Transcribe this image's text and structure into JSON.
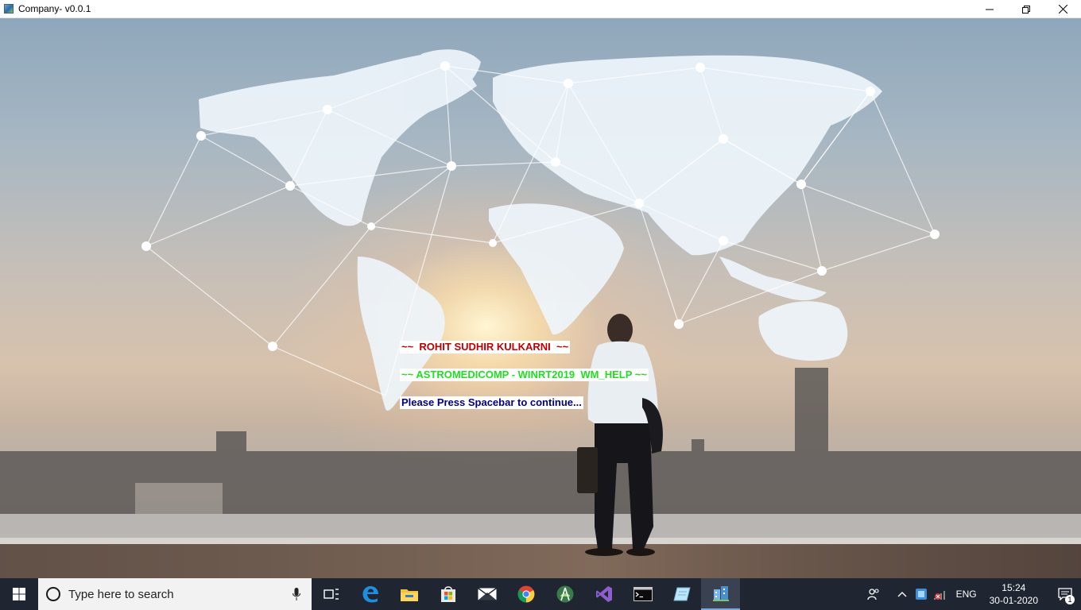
{
  "window": {
    "title": "Company- v0.0.1"
  },
  "messages": {
    "name_line": "~~  ROHIT SUDHIR KULKARNI  ~~",
    "app_line": "~~ ASTROMEDICOMP - WINRT2019  WM_HELP ~~",
    "prompt_line": "Please Press Spacebar to continue...",
    "colors": {
      "name": "#c00000",
      "app": "#22dd22",
      "prompt": "#000080"
    }
  },
  "taskbar": {
    "search_placeholder": "Type here to search",
    "pinned": [
      "task-view-icon",
      "edge-icon",
      "file-explorer-icon",
      "store-icon",
      "mail-icon",
      "chrome-icon",
      "android-studio-icon",
      "visual-studio-icon",
      "terminal-icon",
      "notepad-icon",
      "company-app-icon"
    ],
    "tray": {
      "language": "ENG",
      "time": "15:24",
      "date": "30-01-2020",
      "notifications": "1"
    }
  }
}
